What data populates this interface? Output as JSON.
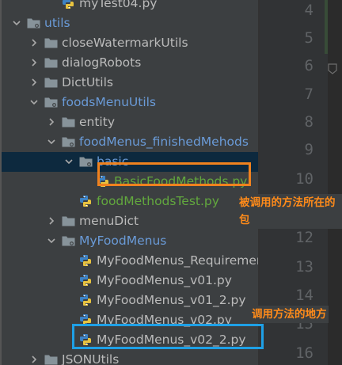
{
  "project_tree": {
    "rows": [
      {
        "label": "myTest04.py",
        "kind": "py",
        "expanded": null,
        "selected": false,
        "label_color": "default"
      },
      {
        "label": "utils",
        "kind": "package",
        "expanded": true,
        "selected": false,
        "label_color": "package"
      },
      {
        "label": "closeWatermarkUtils",
        "kind": "folder",
        "expanded": false,
        "selected": false,
        "label_color": "default"
      },
      {
        "label": "dialogRobots",
        "kind": "folder",
        "expanded": false,
        "selected": false,
        "label_color": "default"
      },
      {
        "label": "DictUtils",
        "kind": "folder",
        "expanded": false,
        "selected": false,
        "label_color": "default"
      },
      {
        "label": "foodsMenuUtils",
        "kind": "package",
        "expanded": true,
        "selected": false,
        "label_color": "package"
      },
      {
        "label": "entity",
        "kind": "folder",
        "expanded": false,
        "selected": false,
        "label_color": "default"
      },
      {
        "label": "foodMenus_finishedMehods",
        "kind": "package",
        "expanded": true,
        "selected": false,
        "label_color": "package"
      },
      {
        "label": "basic",
        "kind": "package",
        "expanded": true,
        "selected": true,
        "label_color": "package"
      },
      {
        "label": "BasicFoodMethods.py",
        "kind": "py",
        "expanded": null,
        "selected": false,
        "label_color": "green"
      },
      {
        "label": "foodMethodsTest.py",
        "kind": "py",
        "expanded": null,
        "selected": false,
        "label_color": "green"
      },
      {
        "label": "menuDict",
        "kind": "folder",
        "expanded": false,
        "selected": false,
        "label_color": "default"
      },
      {
        "label": "MyFoodMenus",
        "kind": "package",
        "expanded": true,
        "selected": false,
        "label_color": "package"
      },
      {
        "label": "MyFoodMenus_Requiremen",
        "kind": "py",
        "expanded": null,
        "selected": false,
        "label_color": "default"
      },
      {
        "label": "MyFoodMenus_v01.py",
        "kind": "py",
        "expanded": null,
        "selected": false,
        "label_color": "default"
      },
      {
        "label": "MyFoodMenus_v01_2.py",
        "kind": "py",
        "expanded": null,
        "selected": false,
        "label_color": "default"
      },
      {
        "label": "MyFoodMenus_v02.py",
        "kind": "py",
        "expanded": null,
        "selected": false,
        "label_color": "default"
      },
      {
        "label": "MyFoodMenus_v02_2.py",
        "kind": "py",
        "expanded": null,
        "selected": false,
        "label_color": "default"
      },
      {
        "label": "JSONUtils",
        "kind": "folder",
        "expanded": false,
        "selected": false,
        "label_color": "default"
      }
    ]
  },
  "gutter": {
    "line_numbers": [
      "4",
      "5",
      "6",
      "7",
      "8",
      "9",
      "10",
      "11",
      "12",
      "13",
      "14",
      "15",
      "16"
    ]
  },
  "annotations": {
    "called_methods_note": "被调用的方法所在的包",
    "calling_site_note": "调用方法的地方"
  },
  "colors": {
    "tree_bg": "#3c3f41",
    "selection_bg": "#0d293e",
    "package_text": "#6a9bd8",
    "vcs_added_text": "#62a83e",
    "annotation_text": "#ff8b1a",
    "highlight_orange": "#f0821e",
    "highlight_blue": "#1ea0e6"
  }
}
